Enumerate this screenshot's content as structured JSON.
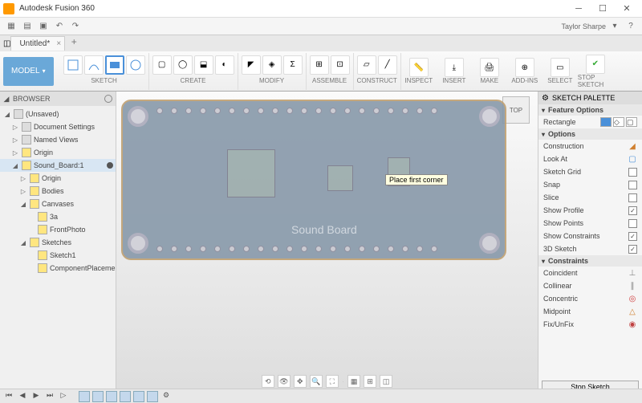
{
  "app": {
    "title": "Autodesk Fusion 360",
    "user": "Taylor Sharpe"
  },
  "tab": {
    "name": "Untitled*"
  },
  "ribbon": {
    "model_btn": "MODEL",
    "groups": {
      "sketch": "SKETCH",
      "create": "CREATE",
      "modify": "MODIFY",
      "assemble": "ASSEMBLE",
      "construct": "CONSTRUCT",
      "inspect": "INSPECT",
      "insert": "INSERT",
      "make": "MAKE",
      "addins": "ADD-INS",
      "select": "SELECT",
      "stop_sketch": "STOP SKETCH"
    }
  },
  "browser": {
    "title": "BROWSER",
    "nodes": [
      {
        "lvl": 0,
        "twist": "◢",
        "icon": "cube",
        "label": "(Unsaved)"
      },
      {
        "lvl": 1,
        "twist": "▷",
        "icon": "doc",
        "label": "Document Settings"
      },
      {
        "lvl": 1,
        "twist": "▷",
        "icon": "doc",
        "label": "Named Views"
      },
      {
        "lvl": 1,
        "twist": "▷",
        "icon": "bulb",
        "label": "Origin"
      },
      {
        "lvl": 1,
        "twist": "◢",
        "icon": "bulb",
        "sel": true,
        "label": "Sound_Board:1",
        "radio": true
      },
      {
        "lvl": 2,
        "twist": "▷",
        "icon": "bulb",
        "label": "Origin"
      },
      {
        "lvl": 2,
        "twist": "▷",
        "icon": "bulb",
        "label": "Bodies"
      },
      {
        "lvl": 2,
        "twist": "◢",
        "icon": "bulb",
        "label": "Canvases"
      },
      {
        "lvl": 3,
        "twist": "",
        "icon": "bulb",
        "label": "3a"
      },
      {
        "lvl": 3,
        "twist": "",
        "icon": "bulb",
        "label": "FrontPhoto"
      },
      {
        "lvl": 2,
        "twist": "◢",
        "icon": "bulb",
        "label": "Sketches"
      },
      {
        "lvl": 3,
        "twist": "",
        "icon": "bulb",
        "label": "Sketch1"
      },
      {
        "lvl": 3,
        "twist": "",
        "icon": "bulb",
        "label": "ComponentPlacement"
      }
    ]
  },
  "canvas": {
    "tooltip": "Place first corner",
    "pcb_text": "Sound Board",
    "viewcube": "TOP"
  },
  "palette": {
    "title": "SKETCH PALETTE",
    "feature_options": "Feature Options",
    "feature_rect": "Rectangle",
    "options_label": "Options",
    "options": [
      {
        "label": "Construction",
        "icon": "◢",
        "color": "#d08030"
      },
      {
        "label": "Look At",
        "icon": "▢",
        "color": "#4a90d9"
      },
      {
        "label": "Sketch Grid",
        "chk": ""
      },
      {
        "label": "Snap",
        "chk": ""
      },
      {
        "label": "Slice",
        "chk": ""
      },
      {
        "label": "Show Profile",
        "chk": "✓"
      },
      {
        "label": "Show Points",
        "chk": ""
      },
      {
        "label": "Show Constraints",
        "chk": "✓"
      },
      {
        "label": "3D Sketch",
        "chk": "✓"
      }
    ],
    "constraints_label": "Constraints",
    "constraints": [
      {
        "label": "Coincident",
        "icon": "⊥",
        "color": "#888"
      },
      {
        "label": "Collinear",
        "icon": "∥",
        "color": "#888"
      },
      {
        "label": "Concentric",
        "icon": "◎",
        "color": "#d04040"
      },
      {
        "label": "Midpoint",
        "icon": "△",
        "color": "#d08030"
      },
      {
        "label": "Fix/UnFix",
        "icon": "◉",
        "color": "#c04040"
      }
    ],
    "stop_sketch": "Stop Sketch"
  }
}
